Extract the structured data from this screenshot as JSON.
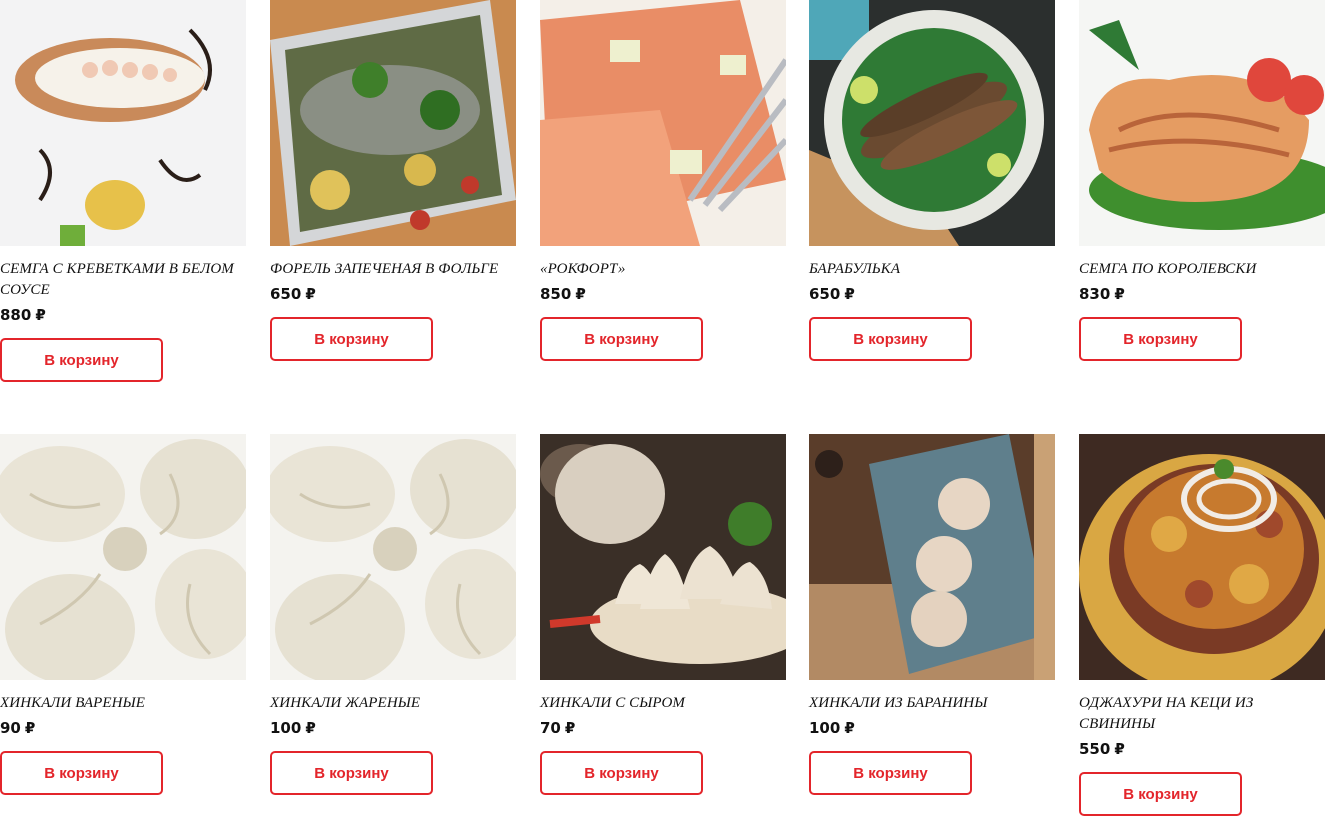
{
  "currency": "₽",
  "add_to_cart": "В корзину",
  "products": [
    {
      "title": "Семга с креветками в белом соусе",
      "price": "880",
      "image": "salmon-shrimp-sauce-photo"
    },
    {
      "title": "Форель запеченая в фольге",
      "price": "650",
      "image": "baked-trout-foil-photo"
    },
    {
      "title": "«Рокфорт»",
      "price": "850",
      "image": "roquefort-salmon-photo"
    },
    {
      "title": "Барабулька",
      "price": "650",
      "image": "red-mullet-photo"
    },
    {
      "title": "Семга по королевски",
      "price": "830",
      "image": "royal-salmon-steak-photo"
    },
    {
      "title": "Хинкали вареные",
      "price": "90",
      "image": "boiled-khinkali-photo"
    },
    {
      "title": "Хинкали жареные",
      "price": "100",
      "image": "fried-khinkali-photo"
    },
    {
      "title": "Хинкали с сыром",
      "price": "70",
      "image": "cheese-khinkali-photo"
    },
    {
      "title": "Хинкали из баранины",
      "price": "100",
      "image": "lamb-khinkali-photo"
    },
    {
      "title": "Оджахури на кеци из свинины",
      "price": "550",
      "image": "pork-ojakhuri-photo"
    }
  ]
}
